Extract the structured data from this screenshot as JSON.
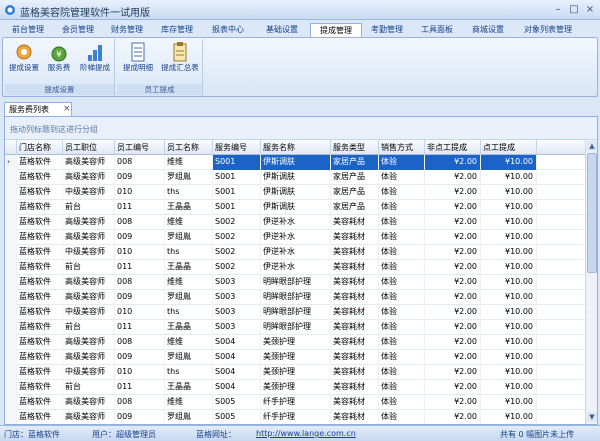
{
  "window": {
    "title": "蓝格美容院管理软件一试用版",
    "min": "–",
    "max": "□",
    "close": "×"
  },
  "menu_tabs": [
    "前台管理",
    "会员管理",
    "财务管理",
    "库存管理",
    "报表中心",
    "基础设置",
    "提成管理",
    "考勤管理",
    "工具面板",
    "商城设置",
    "对象列表管理"
  ],
  "active_tab": "提成管理",
  "ribbon": {
    "group1": {
      "label": "提成设置",
      "buttons": [
        "提成设置",
        "服务费",
        "阶梯提成"
      ]
    },
    "group2": {
      "label": "员工提成",
      "buttons": [
        "提成明细",
        "提成汇总表"
      ]
    }
  },
  "doc_tab": {
    "label": "服务费列表",
    "close": "×"
  },
  "group_hint": "拖动列标题到这进行分组",
  "grid": {
    "columns": [
      "门店名称",
      "员工职位",
      "员工编号",
      "员工名称",
      "服务编号",
      "服务名称",
      "服务类型",
      "销售方式",
      "非点工提成",
      "点工提成"
    ],
    "rows": [
      [
        "蓝格软件",
        "高级美容师",
        "008",
        "维维",
        "S001",
        "伊斯调肤",
        "家居产品",
        "体验",
        "¥2.00",
        "¥10.00"
      ],
      [
        "蓝格软件",
        "高级美容师",
        "009",
        "罗组胤",
        "S001",
        "伊斯调肤",
        "家居产品",
        "体验",
        "¥2.00",
        "¥10.00"
      ],
      [
        "蓝格软件",
        "中级美容师",
        "010",
        "ths",
        "S001",
        "伊斯调肤",
        "家居产品",
        "体验",
        "¥2.00",
        "¥10.00"
      ],
      [
        "蓝格软件",
        "前台",
        "011",
        "王晶晶",
        "S001",
        "伊斯调肤",
        "家居产品",
        "体验",
        "¥2.00",
        "¥10.00"
      ],
      [
        "蓝格软件",
        "高级美容师",
        "008",
        "维维",
        "S002",
        "伊逆补水",
        "美容耗材",
        "体验",
        "¥2.00",
        "¥10.00"
      ],
      [
        "蓝格软件",
        "高级美容师",
        "009",
        "罗组胤",
        "S002",
        "伊逆补水",
        "美容耗材",
        "体验",
        "¥2.00",
        "¥10.00"
      ],
      [
        "蓝格软件",
        "中级美容师",
        "010",
        "ths",
        "S002",
        "伊逆补水",
        "美容耗材",
        "体验",
        "¥2.00",
        "¥10.00"
      ],
      [
        "蓝格软件",
        "前台",
        "011",
        "王晶晶",
        "S002",
        "伊逆补水",
        "美容耗材",
        "体验",
        "¥2.00",
        "¥10.00"
      ],
      [
        "蓝格软件",
        "高级美容师",
        "008",
        "维维",
        "S003",
        "明眸眼部护理",
        "美容耗材",
        "体验",
        "¥2.00",
        "¥10.00"
      ],
      [
        "蓝格软件",
        "高级美容师",
        "009",
        "罗组胤",
        "S003",
        "明眸眼部护理",
        "美容耗材",
        "体验",
        "¥2.00",
        "¥10.00"
      ],
      [
        "蓝格软件",
        "中级美容师",
        "010",
        "ths",
        "S003",
        "明眸眼部护理",
        "美容耗材",
        "体验",
        "¥2.00",
        "¥10.00"
      ],
      [
        "蓝格软件",
        "前台",
        "011",
        "王晶晶",
        "S003",
        "明眸眼部护理",
        "美容耗材",
        "体验",
        "¥2.00",
        "¥10.00"
      ],
      [
        "蓝格软件",
        "高级美容师",
        "008",
        "维维",
        "S004",
        "美颈护理",
        "美容耗材",
        "体验",
        "¥2.00",
        "¥10.00"
      ],
      [
        "蓝格软件",
        "高级美容师",
        "009",
        "罗组胤",
        "S004",
        "美颈护理",
        "美容耗材",
        "体验",
        "¥2.00",
        "¥10.00"
      ],
      [
        "蓝格软件",
        "中级美容师",
        "010",
        "ths",
        "S004",
        "美颈护理",
        "美容耗材",
        "体验",
        "¥2.00",
        "¥10.00"
      ],
      [
        "蓝格软件",
        "前台",
        "011",
        "王晶晶",
        "S004",
        "美颈护理",
        "美容耗材",
        "体验",
        "¥2.00",
        "¥10.00"
      ],
      [
        "蓝格软件",
        "高级美容师",
        "008",
        "维维",
        "S005",
        "纤手护理",
        "美容耗材",
        "体验",
        "¥2.00",
        "¥10.00"
      ],
      [
        "蓝格软件",
        "高级美容师",
        "009",
        "罗组胤",
        "S005",
        "纤手护理",
        "美容耗材",
        "体验",
        "¥2.00",
        "¥10.00"
      ]
    ],
    "selected_row_marker": "›"
  },
  "statusbar": {
    "store": "门店：蓝格软件",
    "user": "用户：超级管理员",
    "website_label": "蓝格网址：",
    "website_url": "http://www.lange.com.cn",
    "right": "共有 0 幅图片未上传"
  },
  "colors": {
    "accent": "#1c63c8",
    "frame": "#dbe7f6",
    "tab_text": "#15428b"
  }
}
